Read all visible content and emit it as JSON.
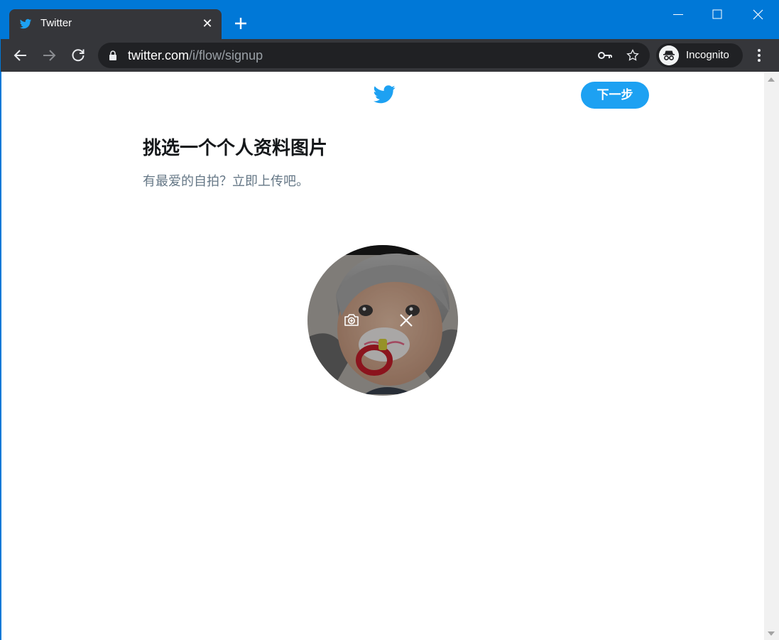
{
  "browser": {
    "tab_title": "Twitter",
    "tab_close": "✕",
    "url_host": "twitter.com",
    "url_path": "/i/flow/signup",
    "profile_label": "Incognito"
  },
  "page": {
    "next_button": "下一步",
    "title": "挑选一个个人资料图片",
    "subtitle": "有最爱的自拍？立即上传吧。"
  },
  "colors": {
    "brand": "#1da1f2",
    "window_frame": "#0078d7",
    "toolbar": "#35363a"
  },
  "icons": {
    "tab_favicon": "twitter-bird-icon",
    "brand_logo": "twitter-bird-icon",
    "avatar_add": "camera-plus-icon",
    "avatar_remove": "close-icon"
  }
}
